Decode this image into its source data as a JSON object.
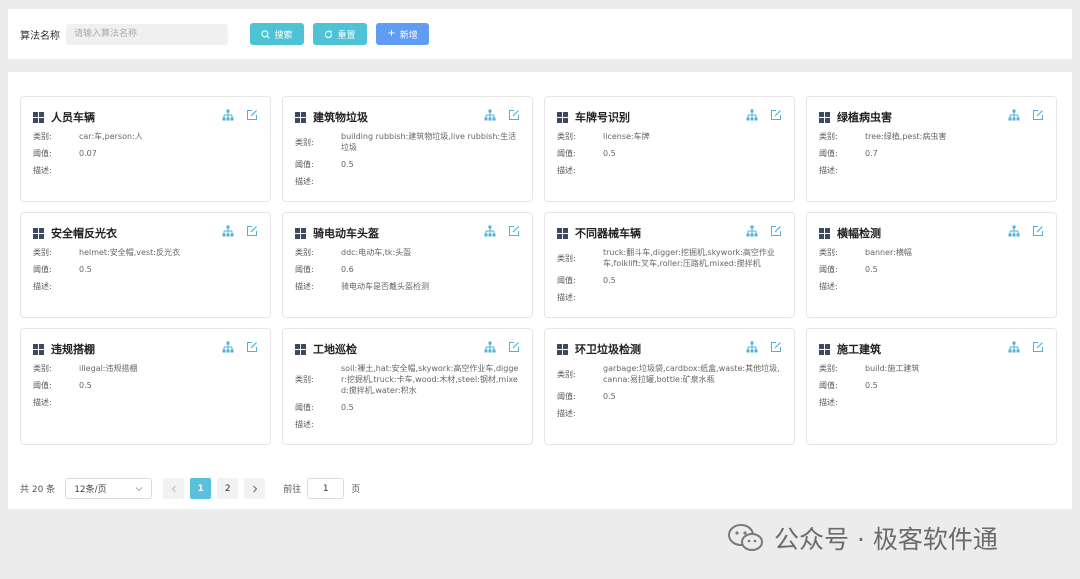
{
  "search": {
    "label": "算法名称",
    "placeholder": "请输入算法名称",
    "search_label": "搜索",
    "reset_label": "重置",
    "add_label": "新增"
  },
  "fields": {
    "category": "类别:",
    "threshold": "阈值:",
    "description": "描述:"
  },
  "cards": [
    {
      "title": "人员车辆",
      "category": "car:车,person:人",
      "threshold": "0.07",
      "description": ""
    },
    {
      "title": "建筑物垃圾",
      "category": "building rubbish:建筑物垃圾,live rubbish:生活垃圾",
      "threshold": "0.5",
      "description": ""
    },
    {
      "title": "车牌号识别",
      "category": "license:车牌",
      "threshold": "0.5",
      "description": ""
    },
    {
      "title": "绿植病虫害",
      "category": "tree:绿植,pest:病虫害",
      "threshold": "0.7",
      "description": ""
    },
    {
      "title": "安全帽反光衣",
      "category": "helmet:安全帽,vest:反光衣",
      "threshold": "0.5",
      "description": ""
    },
    {
      "title": "骑电动车头盔",
      "category": "ddc:电动车,tk:头盔",
      "threshold": "0.6",
      "description": "骑电动车是否戴头盔检测"
    },
    {
      "title": "不同器械车辆",
      "category": "truck:翻斗车,digger:挖掘机,skywork:高空作业车,folklift:叉车,roller:压路机,mixed:搅拌机",
      "threshold": "0.5",
      "description": ""
    },
    {
      "title": "横幅检测",
      "category": "banner:横幅",
      "threshold": "0.5",
      "description": ""
    },
    {
      "title": "违规搭棚",
      "category": "illegal:违规搭棚",
      "threshold": "0.5",
      "description": ""
    },
    {
      "title": "工地巡检",
      "category": "soil:裸土,hat:安全帽,skywork:高空作业车,digger:挖掘机,truck:卡车,wood:木材,steel:钢材,mixed:搅拌机,water:积水",
      "threshold": "0.5",
      "description": ""
    },
    {
      "title": "环卫垃圾检测",
      "category": "garbage:垃圾袋,cardbox:纸盒,waste:其他垃圾,canna:易拉罐,bottle:矿泉水瓶",
      "threshold": "0.5",
      "description": ""
    },
    {
      "title": "施工建筑",
      "category": "build:施工建筑",
      "threshold": "0.5",
      "description": ""
    }
  ],
  "pagination": {
    "total": "共 20 条",
    "page_size": "12条/页",
    "pages": [
      "1",
      "2"
    ],
    "current": "1",
    "goto_label": "前往",
    "goto_value": "1",
    "page_unit": "页"
  },
  "watermark": {
    "text": "公众号 · 极客软件通"
  },
  "colors": {
    "accent": "#4fc3d6",
    "primary": "#5f9cf3",
    "active_page": "#5bc0de"
  }
}
